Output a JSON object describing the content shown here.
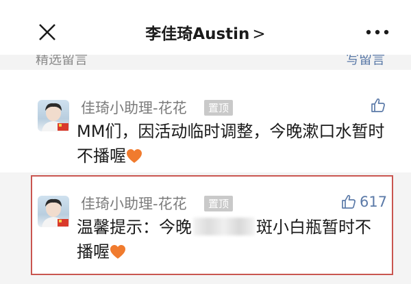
{
  "header": {
    "title": "李佳琦Austin",
    "chevron": ">",
    "close_icon": "close-icon",
    "more_icon": "more-icon"
  },
  "section": {
    "left_label": "精选留言",
    "right_label": "写留言"
  },
  "comments": [
    {
      "author": "佳琦小助理-花花",
      "pin_label": "置顶",
      "text": "MM们，因活动临时调整，今晚漱口水暂时不播喔",
      "like_count": "",
      "emoji": "orange-heart-icon",
      "highlighted": false
    },
    {
      "author": "佳琦小助理-花花",
      "pin_label": "置顶",
      "text_before_blur": "温馨提示：今晚",
      "text_after_blur": "斑小白瓶暂时不播喔",
      "like_count": "617",
      "emoji": "orange-heart-icon",
      "highlighted": true
    }
  ],
  "colors": {
    "accent_link": "#5b7aa8",
    "highlight_border": "#c9554f",
    "heart": "#f07b2e"
  }
}
